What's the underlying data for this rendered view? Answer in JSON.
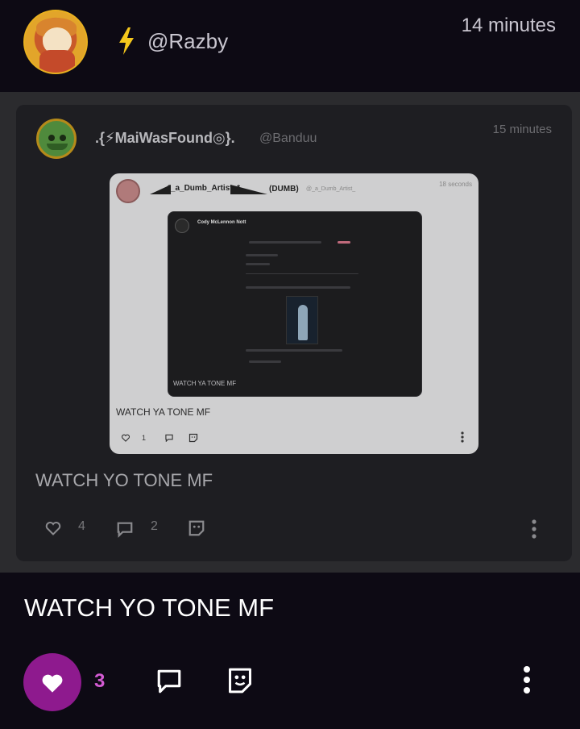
{
  "post": {
    "handle": "@Razby",
    "time": "14 minutes",
    "text": "WATCH YO TONE MF",
    "like_count": "3"
  },
  "quoted_post": {
    "display_name": ".{⚡MaiWasFound◎}.",
    "handle": "@Banduu",
    "time": "15 minutes",
    "text": "WATCH YO TONE MF",
    "like_count": "4",
    "comment_count": "2"
  },
  "nested_post": {
    "display_name": "*_a_Dumb_Artist_*",
    "tag": "(DUMB)",
    "handle": "@_a_Dumb_Artist_",
    "time": "18 seconds",
    "text": "WATCH YA TONE MF",
    "like_count": "1"
  },
  "screenshot_post": {
    "display_name": "Cody McLennon Nott",
    "text": "WATCH YA TONE MF"
  },
  "colors": {
    "background": "#0d0a14",
    "like_active": "#8e1a8e",
    "like_count": "#d35bd3"
  }
}
